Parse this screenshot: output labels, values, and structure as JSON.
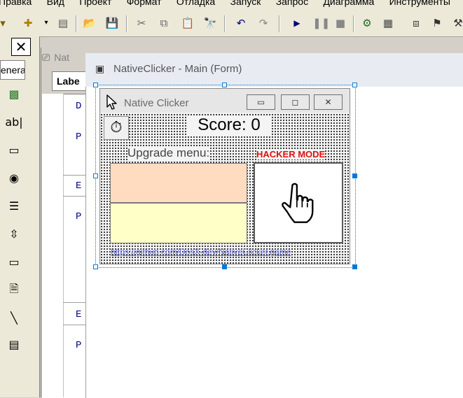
{
  "menubar": {
    "items": [
      "Правка",
      "Вид",
      "Проект",
      "Формат",
      "Отладка",
      "Запуск",
      "Запрос",
      "Диаграмма",
      "Инструменты"
    ]
  },
  "toolbox": {
    "close_glyph": "✕",
    "tab_label": "eneral"
  },
  "code_window": {
    "title": "Nat",
    "combo_value": "Labe",
    "lines": [
      "D",
      "P",
      "E",
      "P",
      "E",
      "P"
    ]
  },
  "designer": {
    "title": "NativeClicker - Main (Form)"
  },
  "form": {
    "title": "Native Clicker",
    "score": "Score: 0",
    "upgrade_label": "Upgrade menu:",
    "hacker_mode": "HACKER MODE",
    "link": "https://github.com/DosX-dev/NativeClicker.game",
    "upgrade_colors": [
      "#ffdcc0",
      "#ffffc8"
    ]
  },
  "icons": {
    "toolbar": [
      "save-icon",
      "open-folder-icon",
      "cut-icon",
      "copy-icon",
      "paste-icon",
      "find-icon",
      "undo-icon",
      "redo-icon",
      "play-icon",
      "pause-icon",
      "stop-icon"
    ],
    "form": [
      "cursor-icon",
      "stopwatch-icon",
      "hand-pointer-icon"
    ]
  }
}
